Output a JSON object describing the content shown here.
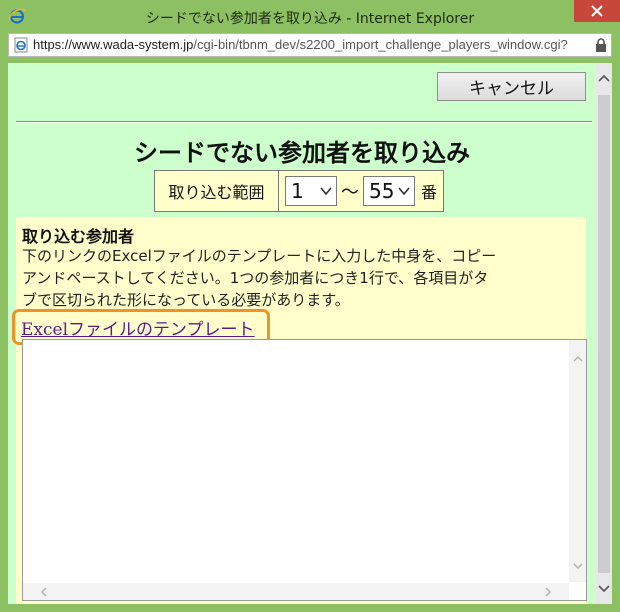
{
  "window": {
    "title": "シードでない参加者を取り込み - Internet Explorer",
    "url_main": "https://www.wada-system.jp",
    "url_path": "/cgi-bin/tbnm_dev/s2200_import_challenge_players_window.cgi?",
    "icons": {
      "app": "ie-logo-icon",
      "page": "ie-page-icon",
      "lock": "lock-icon",
      "close": "close-icon"
    },
    "accent": "#8dc062",
    "close_color": "#c7473a"
  },
  "toolbar": {
    "cancel_label": "キャンセル"
  },
  "page": {
    "title": "シードでない参加者を取り込み",
    "background": "#ccffcc"
  },
  "range": {
    "label": "取り込む範囲",
    "from_value": "1",
    "separator": "〜",
    "to_value": "55",
    "suffix": "番"
  },
  "import": {
    "section_label": "取り込む参加者",
    "description_lines": [
      "下のリンクのExcelファイルのテンプレートに入力した中身を、コピー",
      "アンドペーストしてください。1つの参加者につき1行で、各項目がタ",
      "ブで区切られた形になっている必要があります。"
    ],
    "template_link": "Excelファイルのテンプレート",
    "textarea_value": "",
    "highlight_color": "#f0922a"
  }
}
